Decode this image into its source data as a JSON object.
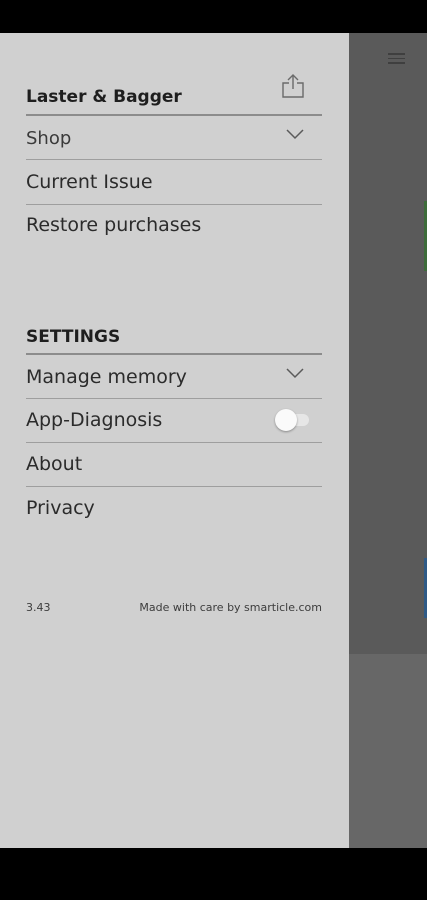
{
  "drawer": {
    "brand_title": "Laster & Bagger",
    "menu_items": [
      {
        "label": "Shop"
      },
      {
        "label": "Current Issue"
      },
      {
        "label": "Restore purchases"
      }
    ],
    "settings": {
      "heading": "SETTINGS",
      "items": [
        {
          "label": "Manage memory"
        },
        {
          "label": "App-Diagnosis",
          "toggle_on": false
        },
        {
          "label": "About"
        },
        {
          "label": "Privacy"
        }
      ]
    },
    "footer": {
      "version": "3.43",
      "credit": "Made with care by smarticle.com"
    }
  },
  "icons": {
    "share": "share-icon",
    "chevron": "chevron-down-icon",
    "menu": "hamburger-menu-icon"
  },
  "colors": {
    "drawer_background": "#d0d0d0",
    "backdrop": "#676767",
    "accent_green": "#2e7d32",
    "accent_blue": "#1565c0"
  }
}
